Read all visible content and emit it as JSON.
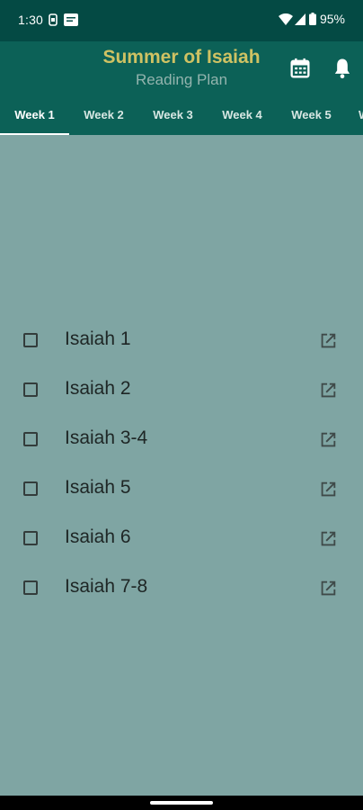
{
  "status_bar": {
    "time": "1:30",
    "battery_pct": "95%"
  },
  "header": {
    "title": "Summer of Isaiah",
    "subtitle": "Reading Plan"
  },
  "tabs": [
    {
      "label": "Week 1",
      "active": true
    },
    {
      "label": "Week 2",
      "active": false
    },
    {
      "label": "Week 3",
      "active": false
    },
    {
      "label": "Week 4",
      "active": false
    },
    {
      "label": "Week 5",
      "active": false
    },
    {
      "label": "W",
      "active": false
    }
  ],
  "readings": [
    {
      "label": "Isaiah 1",
      "checked": false
    },
    {
      "label": "Isaiah 2",
      "checked": false
    },
    {
      "label": "Isaiah 3-4",
      "checked": false
    },
    {
      "label": "Isaiah 5",
      "checked": false
    },
    {
      "label": "Isaiah 6",
      "checked": false
    },
    {
      "label": "Isaiah 7-8",
      "checked": false
    }
  ],
  "icons": {
    "calendar": "calendar-icon",
    "bell": "bell-icon",
    "open_external": "open-in-new-icon"
  },
  "colors": {
    "status_bar": "#044a44",
    "app_bar": "#0c6157",
    "title": "#cfc263",
    "background": "#7fa5a3"
  }
}
